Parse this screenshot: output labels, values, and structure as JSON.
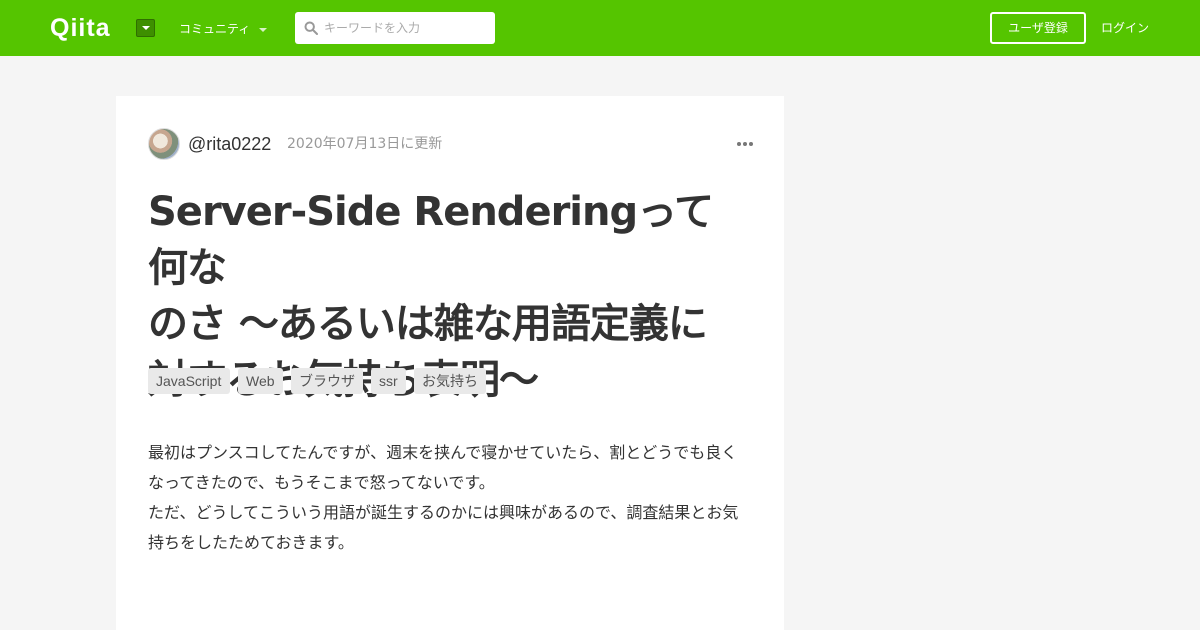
{
  "header": {
    "logo_text": "Qiita",
    "community_label": "コミュニティ",
    "search": {
      "placeholder": "キーワードを入力",
      "value": ""
    },
    "signup_label": "ユーザ登録",
    "login_label": "ログイン"
  },
  "article": {
    "author": "@rita0222",
    "updated": "2020年07月13日に更新",
    "title_lines": [
      "Server-Side Renderingって何な",
      "のさ ～あるいは雑な用語定義に",
      "対するお気持ち表明～"
    ],
    "tags": [
      "JavaScript",
      "Web",
      "ブラウザ",
      "ssr",
      "お気持ち"
    ],
    "body_lines": [
      "最初はプンスコしてたんですが、週末を挟んで寝かせていたら、割とどうでも良く",
      "なってきたので、もうそこまで怒ってないです。",
      "ただ、どうしてこういう用語が誕生するのかには興味があるので、調査結果とお気",
      "持ちをしたためておきます。"
    ]
  },
  "colors": {
    "brand": "#55c500",
    "background": "#f5f5f5",
    "text": "#333333",
    "muted": "#999999",
    "tag_bg": "#e9e9e9"
  },
  "icons": {
    "search": "search-icon",
    "menu": "chevron-down-icon",
    "more": "more-icon"
  }
}
